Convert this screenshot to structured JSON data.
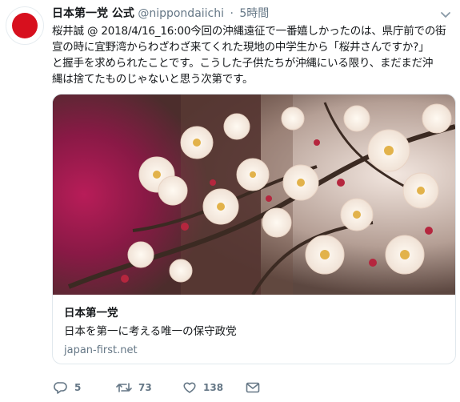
{
  "tweet": {
    "account_name": "日本第一党 公式",
    "handle": "@nippondaiichi",
    "separator": "·",
    "time": "5時間",
    "text_lines": [
      "桜井誠 @ 2018/4/16_16:00今回の沖縄遠征で一番嬉しかったのは、県庁前での街",
      "宣の時に宜野湾からわざわざ来てくれた現地の中学生から「桜井さんですか?」",
      "と握手を求められたことです。こうした子供たちが沖縄にいる限り、まだまだ沖",
      "縄は捨てたものじゃないと思う次第です。"
    ]
  },
  "card": {
    "title": "日本第一党",
    "description": "日本を第一に考える唯一の保守政党",
    "domain": "japan-first.net"
  },
  "actions": {
    "reply_count": "5",
    "retweet_count": "73",
    "like_count": "138"
  },
  "icons": {
    "reply": "reply-icon",
    "retweet": "retweet-icon",
    "like": "heart-icon",
    "message": "envelope-icon",
    "menu": "chevron-down-icon"
  },
  "colors": {
    "avatar_sun": "#d7101e",
    "text_primary": "#14171a",
    "text_secondary": "#657786",
    "border": "#e1e8ed"
  }
}
